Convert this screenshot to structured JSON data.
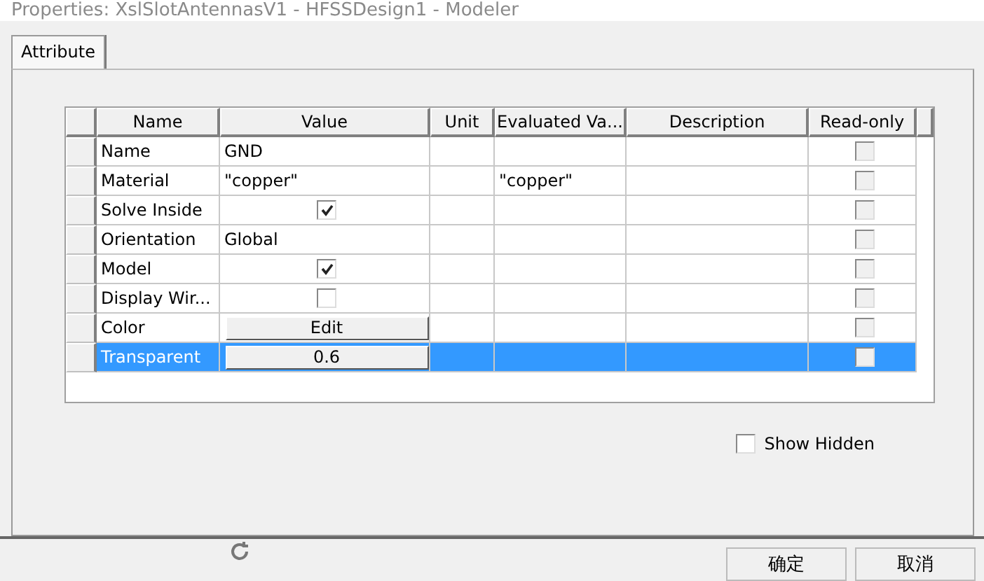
{
  "window": {
    "title": "Properties: XslSlotAntennasV1 - HFSSDesign1 - Modeler"
  },
  "tabs": [
    {
      "label": "Attribute",
      "selected": true
    }
  ],
  "table": {
    "columns": [
      "Name",
      "Value",
      "Unit",
      "Evaluated Va...",
      "Description",
      "Read-only"
    ],
    "rows": [
      {
        "name": "Name",
        "value": {
          "kind": "text",
          "text": "GND"
        },
        "unit": "",
        "evaluated": "",
        "read_only": false,
        "selected": false
      },
      {
        "name": "Material",
        "value": {
          "kind": "text",
          "text": "\"copper\""
        },
        "unit": "",
        "evaluated": "\"copper\"",
        "read_only": false,
        "selected": false
      },
      {
        "name": "Solve Inside",
        "value": {
          "kind": "checkbox",
          "checked": true
        },
        "unit": "",
        "evaluated": "",
        "read_only": false,
        "selected": false
      },
      {
        "name": "Orientation",
        "value": {
          "kind": "text",
          "text": "Global"
        },
        "unit": "",
        "evaluated": "",
        "read_only": false,
        "selected": false
      },
      {
        "name": "Model",
        "value": {
          "kind": "checkbox",
          "checked": true
        },
        "unit": "",
        "evaluated": "",
        "read_only": false,
        "selected": false
      },
      {
        "name": "Display Wir...",
        "value": {
          "kind": "checkbox",
          "checked": false
        },
        "unit": "",
        "evaluated": "",
        "read_only": false,
        "selected": false
      },
      {
        "name": "Color",
        "value": {
          "kind": "button",
          "text": "Edit"
        },
        "unit": "",
        "evaluated": "",
        "read_only": false,
        "selected": false
      },
      {
        "name": "Transparent",
        "value": {
          "kind": "button",
          "text": "0.6"
        },
        "unit": "",
        "evaluated": "",
        "read_only": false,
        "selected": true
      }
    ]
  },
  "show_hidden": {
    "label": "Show Hidden",
    "checked": false
  },
  "buttons": [
    "确定",
    "取消"
  ]
}
